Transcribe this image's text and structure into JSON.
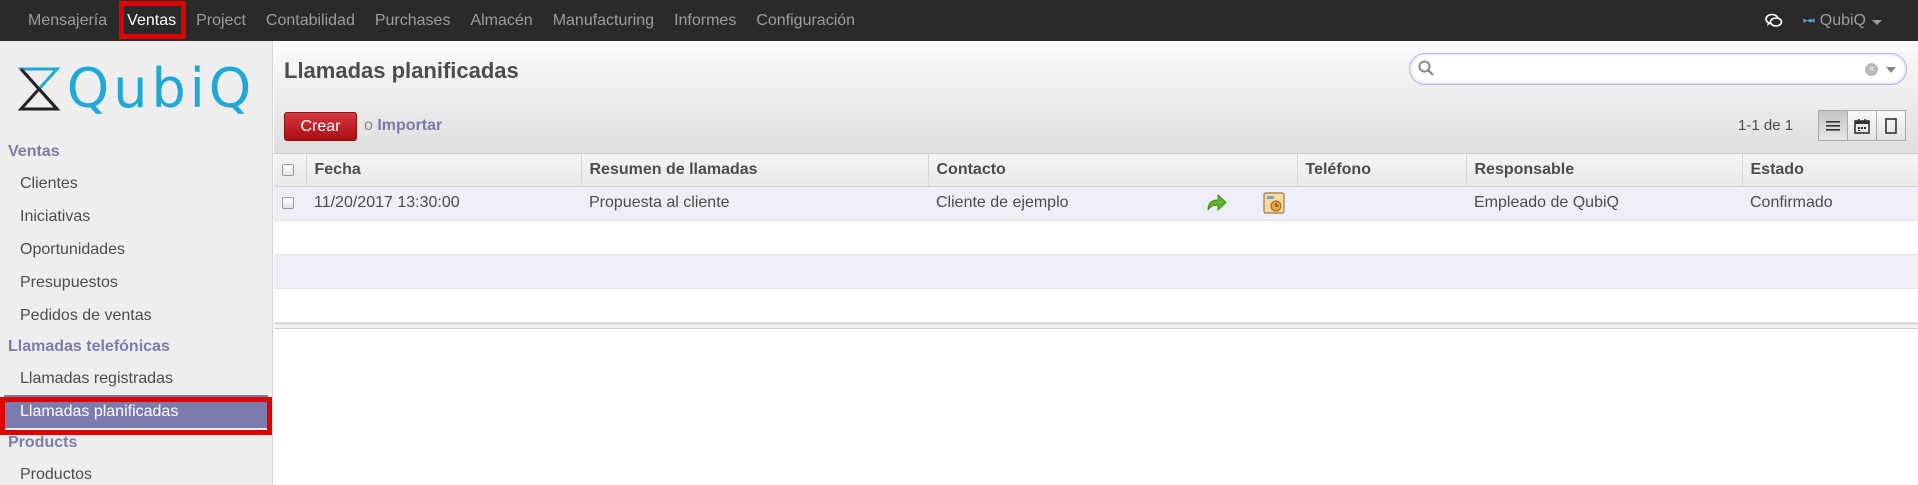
{
  "topbar": {
    "menu": [
      "Mensajería",
      "Ventas",
      "Project",
      "Contabilidad",
      "Purchases",
      "Almacén",
      "Manufacturing",
      "Informes",
      "Configuración"
    ],
    "active": "Ventas",
    "user_name": "QubiQ",
    "chat_icon": "chat-bubbles-icon"
  },
  "sidebar": {
    "logo_text": "QubiQ",
    "sections": [
      {
        "title": "Ventas",
        "items": [
          "Clientes",
          "Iniciativas",
          "Oportunidades",
          "Presupuestos",
          "Pedidos de ventas"
        ]
      },
      {
        "title": "Llamadas telefónicas",
        "items": [
          "Llamadas registradas",
          "Llamadas planificadas"
        ]
      },
      {
        "title": "Products",
        "items": [
          "Productos"
        ]
      }
    ],
    "selected_item": "Llamadas planificadas"
  },
  "header": {
    "title": "Llamadas planificadas",
    "create_label": "Crear",
    "or_label": "o",
    "import_label": "Importar",
    "pager": "1-1 de 1",
    "search_placeholder": ""
  },
  "table": {
    "columns": [
      "Fecha",
      "Resumen de llamadas",
      "Contacto",
      "Teléfono",
      "Responsable",
      "Estado"
    ],
    "rows": [
      {
        "fecha": "11/20/2017 13:30:00",
        "resumen": "Propuesta al cliente",
        "contacto": "Cliente de ejemplo",
        "telefono": "",
        "responsable": "Empleado de QubiQ",
        "estado": "Confirmado"
      }
    ]
  },
  "colors": {
    "topbar_bg": "#2a2a2a",
    "accent_purple": "#7c7bad",
    "create_red": "#c01c1c",
    "highlight_red": "#e00000"
  }
}
